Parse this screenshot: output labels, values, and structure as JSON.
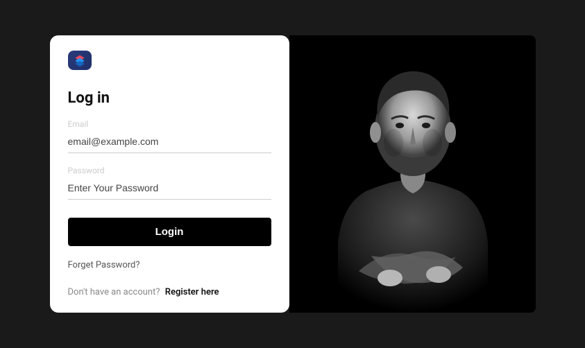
{
  "login": {
    "title": "Log in",
    "email_label": "Email",
    "email_placeholder": "email@example.com",
    "password_label": "Password",
    "password_placeholder": "Enter Your Password",
    "button_label": "Login",
    "forget_label": "Forget Password?",
    "no_account_text": "Don't have an account?",
    "register_label": "Register here"
  },
  "logo": {
    "name": "app-logo",
    "colors": {
      "bg": "#2a3b7a",
      "top": "#e84a5f",
      "mid": "#2196f3",
      "bottom": "#1565c0"
    }
  }
}
